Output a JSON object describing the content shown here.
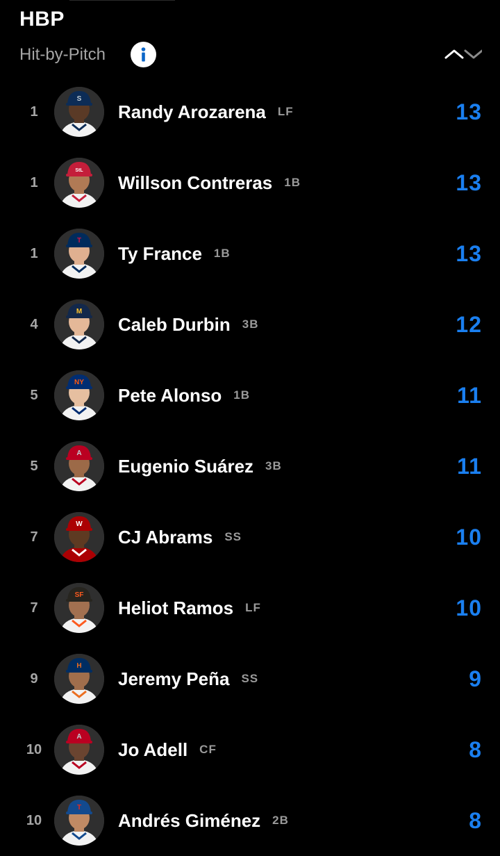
{
  "header": {
    "title": "HBP",
    "subtitle": "Hit-by-Pitch",
    "info_icon": "info-icon",
    "sort_icon": "sort-toggle-icon"
  },
  "colors": {
    "accent": "#1a7ff0",
    "background": "#000000",
    "muted": "#a6a6a6"
  },
  "leaders": [
    {
      "rank": "1",
      "name": "Randy Arozarena",
      "pos": "LF",
      "value": "13",
      "cap": "#0c2c56",
      "cap2": "#0c2c56",
      "logo": "S",
      "logo_color": "#c4ced4",
      "skin": "#5a3a26",
      "jersey": "#f2f2f2",
      "trim": "#0c2c56"
    },
    {
      "rank": "1",
      "name": "Willson Contreras",
      "pos": "1B",
      "value": "13",
      "cap": "#c41e3a",
      "cap2": "#c41e3a",
      "logo": "StL",
      "logo_color": "#ffffff",
      "skin": "#b07a55",
      "jersey": "#f2f2f2",
      "trim": "#c41e3a"
    },
    {
      "rank": "1",
      "name": "Ty France",
      "pos": "1B",
      "value": "13",
      "cap": "#002b5c",
      "cap2": "#002b5c",
      "logo": "T",
      "logo_color": "#d31145",
      "skin": "#e0b090",
      "jersey": "#f2f2f2",
      "trim": "#002b5c"
    },
    {
      "rank": "4",
      "name": "Caleb Durbin",
      "pos": "3B",
      "value": "12",
      "cap": "#12284b",
      "cap2": "#12284b",
      "logo": "M",
      "logo_color": "#ffc52f",
      "skin": "#e4b898",
      "jersey": "#f2f2f2",
      "trim": "#12284b"
    },
    {
      "rank": "5",
      "name": "Pete Alonso",
      "pos": "1B",
      "value": "11",
      "cap": "#002d72",
      "cap2": "#002d72",
      "logo": "NY",
      "logo_color": "#ff5910",
      "skin": "#e6bfa0",
      "jersey": "#f2f2f2",
      "trim": "#002d72"
    },
    {
      "rank": "5",
      "name": "Eugenio Suárez",
      "pos": "3B",
      "value": "11",
      "cap": "#ba0021",
      "cap2": "#ba0021",
      "logo": "A",
      "logo_color": "#c4ced4",
      "skin": "#9c6a48",
      "jersey": "#f2f2f2",
      "trim": "#ba0021"
    },
    {
      "rank": "7",
      "name": "CJ Abrams",
      "pos": "SS",
      "value": "10",
      "cap": "#ab0003",
      "cap2": "#ab0003",
      "logo": "W",
      "logo_color": "#ffffff",
      "skin": "#5e3a22",
      "jersey": "#ab0003",
      "trim": "#ffffff"
    },
    {
      "rank": "7",
      "name": "Heliot Ramos",
      "pos": "LF",
      "value": "10",
      "cap": "#27251f",
      "cap2": "#27251f",
      "logo": "SF",
      "logo_color": "#fd5a1e",
      "skin": "#a27050",
      "jersey": "#f2f2f2",
      "trim": "#fd5a1e"
    },
    {
      "rank": "9",
      "name": "Jeremy Peña",
      "pos": "SS",
      "value": "9",
      "cap": "#002d62",
      "cap2": "#002d62",
      "logo": "H",
      "logo_color": "#eb6e1f",
      "skin": "#a06e4c",
      "jersey": "#f2f2f2",
      "trim": "#eb6e1f"
    },
    {
      "rank": "10",
      "name": "Jo Adell",
      "pos": "CF",
      "value": "8",
      "cap": "#ba0021",
      "cap2": "#ba0021",
      "logo": "A",
      "logo_color": "#c4ced4",
      "skin": "#6a4430",
      "jersey": "#f2f2f2",
      "trim": "#ba0021"
    },
    {
      "rank": "10",
      "name": "Andrés Giménez",
      "pos": "2B",
      "value": "8",
      "cap": "#134a8e",
      "cap2": "#134a8e",
      "logo": "T",
      "logo_color": "#e8291c",
      "skin": "#c08a64",
      "jersey": "#f2f2f2",
      "trim": "#134a8e"
    }
  ]
}
